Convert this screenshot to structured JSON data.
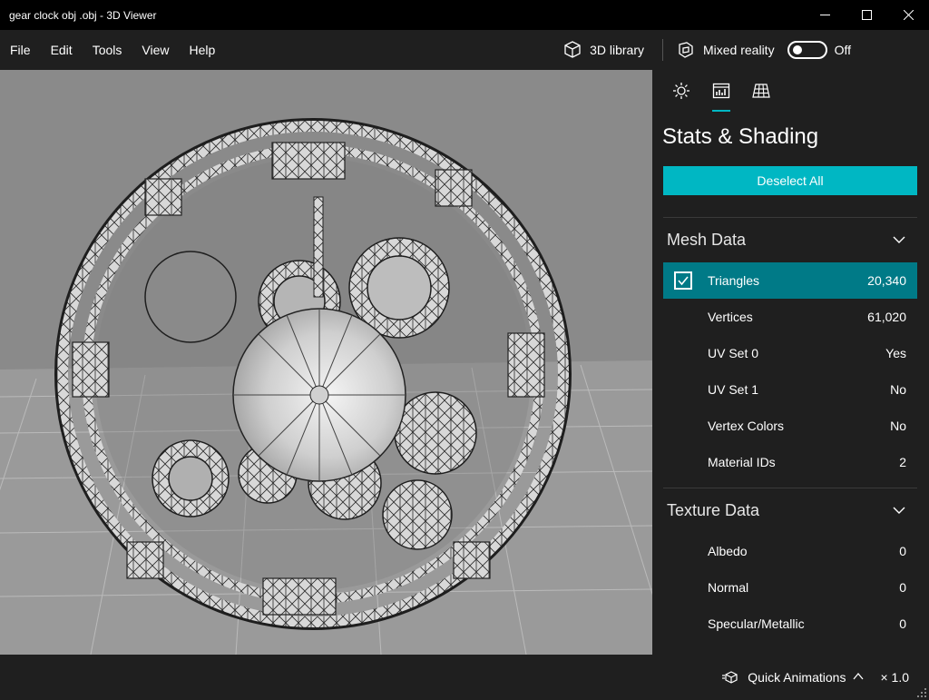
{
  "window": {
    "title": "gear clock obj .obj - 3D Viewer",
    "controls": [
      "minimize-icon",
      "maximize-icon",
      "close-icon"
    ]
  },
  "menu": {
    "items": [
      {
        "label": "File"
      },
      {
        "label": "Edit"
      },
      {
        "label": "Tools"
      },
      {
        "label": "View"
      },
      {
        "label": "Help"
      }
    ],
    "library_label": "3D library",
    "mixed_reality_label": "Mixed reality",
    "mixed_reality_state": "Off"
  },
  "panel": {
    "tabs": [
      {
        "icon": "lighting-icon",
        "active": false
      },
      {
        "icon": "stats-icon",
        "active": true
      },
      {
        "icon": "grid-icon",
        "active": false
      }
    ],
    "title": "Stats & Shading",
    "deselect_label": "Deselect All",
    "mesh_section": {
      "title": "Mesh Data",
      "rows": [
        {
          "label": "Triangles",
          "value": "20,340",
          "checked": true
        },
        {
          "label": "Vertices",
          "value": "61,020"
        },
        {
          "label": "UV Set 0",
          "value": "Yes"
        },
        {
          "label": "UV Set 1",
          "value": "No"
        },
        {
          "label": "Vertex Colors",
          "value": "No"
        },
        {
          "label": "Material IDs",
          "value": "2"
        }
      ]
    },
    "texture_section": {
      "title": "Texture Data",
      "rows": [
        {
          "label": "Albedo",
          "value": "0"
        },
        {
          "label": "Normal",
          "value": "0"
        },
        {
          "label": "Specular/Metallic",
          "value": "0"
        }
      ]
    }
  },
  "status": {
    "quick_animations_label": "Quick Animations",
    "speed": "× 1.0"
  },
  "colors": {
    "accent": "#00b7c3",
    "selected_row": "#007a87",
    "panel_bg": "#1f1f1f",
    "viewport_bg": "#8a8a8a"
  }
}
